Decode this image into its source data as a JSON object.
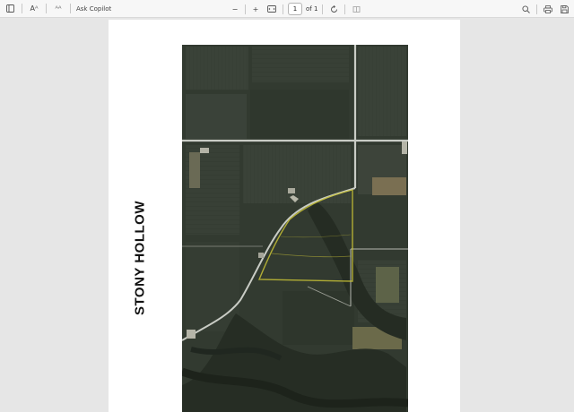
{
  "toolbar": {
    "sidebar_icon": "sidebar-toggle-icon",
    "read_aloud_label": "Aᴬ",
    "immersive_reader_label": "ᴬᴬ",
    "ask_copilot_label": "Ask Copilot",
    "zoom_out_label": "−",
    "zoom_in_label": "+",
    "page_number": "1",
    "page_of": "of 1",
    "print_icon": "print-icon",
    "save_icon": "save-icon"
  },
  "document": {
    "title": "STONY HOLLOW",
    "boundary_color": "#c8c236"
  }
}
